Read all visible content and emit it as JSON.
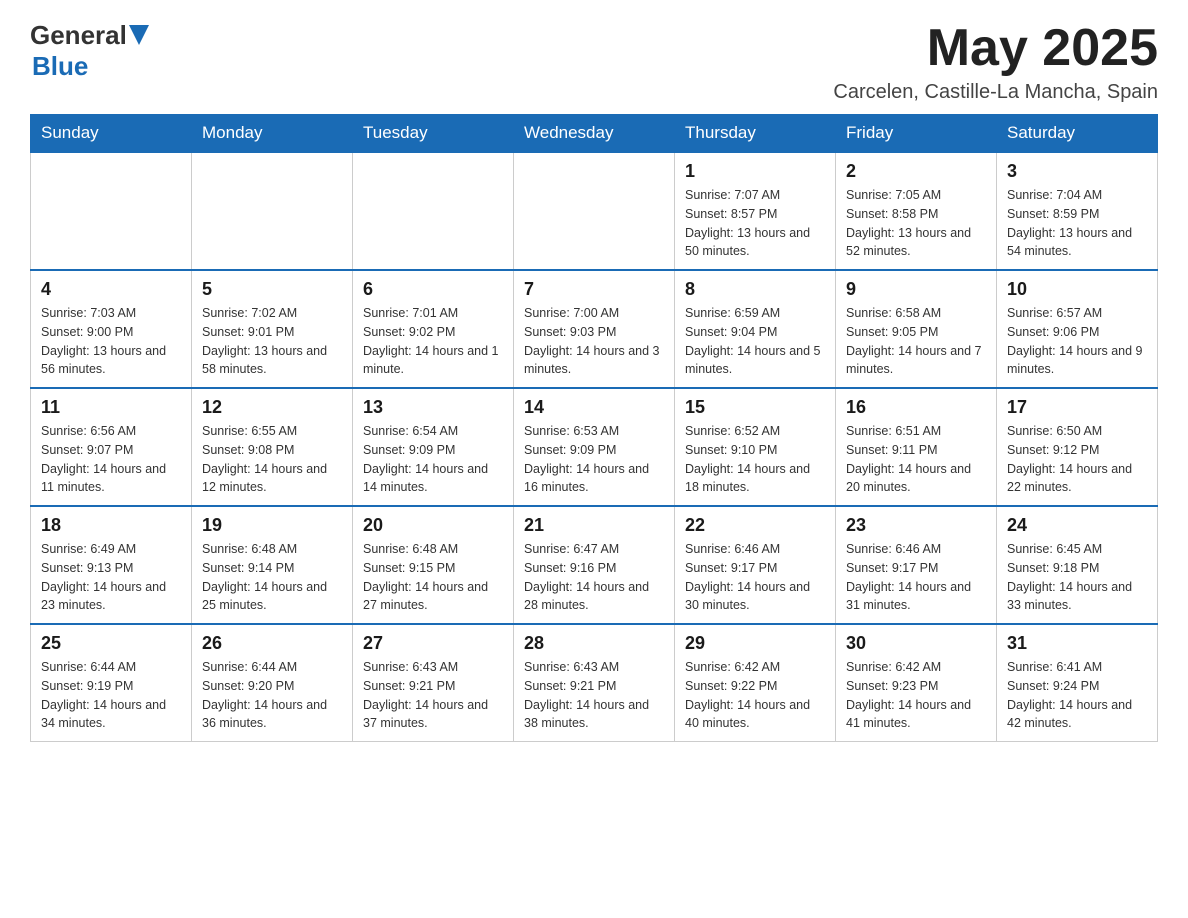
{
  "header": {
    "logo_general": "General",
    "logo_blue": "Blue",
    "month_title": "May 2025",
    "location": "Carcelen, Castille-La Mancha, Spain"
  },
  "weekdays": [
    "Sunday",
    "Monday",
    "Tuesday",
    "Wednesday",
    "Thursday",
    "Friday",
    "Saturday"
  ],
  "weeks": [
    [
      {
        "day": "",
        "sunrise": "",
        "sunset": "",
        "daylight": ""
      },
      {
        "day": "",
        "sunrise": "",
        "sunset": "",
        "daylight": ""
      },
      {
        "day": "",
        "sunrise": "",
        "sunset": "",
        "daylight": ""
      },
      {
        "day": "",
        "sunrise": "",
        "sunset": "",
        "daylight": ""
      },
      {
        "day": "1",
        "sunrise": "Sunrise: 7:07 AM",
        "sunset": "Sunset: 8:57 PM",
        "daylight": "Daylight: 13 hours and 50 minutes."
      },
      {
        "day": "2",
        "sunrise": "Sunrise: 7:05 AM",
        "sunset": "Sunset: 8:58 PM",
        "daylight": "Daylight: 13 hours and 52 minutes."
      },
      {
        "day": "3",
        "sunrise": "Sunrise: 7:04 AM",
        "sunset": "Sunset: 8:59 PM",
        "daylight": "Daylight: 13 hours and 54 minutes."
      }
    ],
    [
      {
        "day": "4",
        "sunrise": "Sunrise: 7:03 AM",
        "sunset": "Sunset: 9:00 PM",
        "daylight": "Daylight: 13 hours and 56 minutes."
      },
      {
        "day": "5",
        "sunrise": "Sunrise: 7:02 AM",
        "sunset": "Sunset: 9:01 PM",
        "daylight": "Daylight: 13 hours and 58 minutes."
      },
      {
        "day": "6",
        "sunrise": "Sunrise: 7:01 AM",
        "sunset": "Sunset: 9:02 PM",
        "daylight": "Daylight: 14 hours and 1 minute."
      },
      {
        "day": "7",
        "sunrise": "Sunrise: 7:00 AM",
        "sunset": "Sunset: 9:03 PM",
        "daylight": "Daylight: 14 hours and 3 minutes."
      },
      {
        "day": "8",
        "sunrise": "Sunrise: 6:59 AM",
        "sunset": "Sunset: 9:04 PM",
        "daylight": "Daylight: 14 hours and 5 minutes."
      },
      {
        "day": "9",
        "sunrise": "Sunrise: 6:58 AM",
        "sunset": "Sunset: 9:05 PM",
        "daylight": "Daylight: 14 hours and 7 minutes."
      },
      {
        "day": "10",
        "sunrise": "Sunrise: 6:57 AM",
        "sunset": "Sunset: 9:06 PM",
        "daylight": "Daylight: 14 hours and 9 minutes."
      }
    ],
    [
      {
        "day": "11",
        "sunrise": "Sunrise: 6:56 AM",
        "sunset": "Sunset: 9:07 PM",
        "daylight": "Daylight: 14 hours and 11 minutes."
      },
      {
        "day": "12",
        "sunrise": "Sunrise: 6:55 AM",
        "sunset": "Sunset: 9:08 PM",
        "daylight": "Daylight: 14 hours and 12 minutes."
      },
      {
        "day": "13",
        "sunrise": "Sunrise: 6:54 AM",
        "sunset": "Sunset: 9:09 PM",
        "daylight": "Daylight: 14 hours and 14 minutes."
      },
      {
        "day": "14",
        "sunrise": "Sunrise: 6:53 AM",
        "sunset": "Sunset: 9:09 PM",
        "daylight": "Daylight: 14 hours and 16 minutes."
      },
      {
        "day": "15",
        "sunrise": "Sunrise: 6:52 AM",
        "sunset": "Sunset: 9:10 PM",
        "daylight": "Daylight: 14 hours and 18 minutes."
      },
      {
        "day": "16",
        "sunrise": "Sunrise: 6:51 AM",
        "sunset": "Sunset: 9:11 PM",
        "daylight": "Daylight: 14 hours and 20 minutes."
      },
      {
        "day": "17",
        "sunrise": "Sunrise: 6:50 AM",
        "sunset": "Sunset: 9:12 PM",
        "daylight": "Daylight: 14 hours and 22 minutes."
      }
    ],
    [
      {
        "day": "18",
        "sunrise": "Sunrise: 6:49 AM",
        "sunset": "Sunset: 9:13 PM",
        "daylight": "Daylight: 14 hours and 23 minutes."
      },
      {
        "day": "19",
        "sunrise": "Sunrise: 6:48 AM",
        "sunset": "Sunset: 9:14 PM",
        "daylight": "Daylight: 14 hours and 25 minutes."
      },
      {
        "day": "20",
        "sunrise": "Sunrise: 6:48 AM",
        "sunset": "Sunset: 9:15 PM",
        "daylight": "Daylight: 14 hours and 27 minutes."
      },
      {
        "day": "21",
        "sunrise": "Sunrise: 6:47 AM",
        "sunset": "Sunset: 9:16 PM",
        "daylight": "Daylight: 14 hours and 28 minutes."
      },
      {
        "day": "22",
        "sunrise": "Sunrise: 6:46 AM",
        "sunset": "Sunset: 9:17 PM",
        "daylight": "Daylight: 14 hours and 30 minutes."
      },
      {
        "day": "23",
        "sunrise": "Sunrise: 6:46 AM",
        "sunset": "Sunset: 9:17 PM",
        "daylight": "Daylight: 14 hours and 31 minutes."
      },
      {
        "day": "24",
        "sunrise": "Sunrise: 6:45 AM",
        "sunset": "Sunset: 9:18 PM",
        "daylight": "Daylight: 14 hours and 33 minutes."
      }
    ],
    [
      {
        "day": "25",
        "sunrise": "Sunrise: 6:44 AM",
        "sunset": "Sunset: 9:19 PM",
        "daylight": "Daylight: 14 hours and 34 minutes."
      },
      {
        "day": "26",
        "sunrise": "Sunrise: 6:44 AM",
        "sunset": "Sunset: 9:20 PM",
        "daylight": "Daylight: 14 hours and 36 minutes."
      },
      {
        "day": "27",
        "sunrise": "Sunrise: 6:43 AM",
        "sunset": "Sunset: 9:21 PM",
        "daylight": "Daylight: 14 hours and 37 minutes."
      },
      {
        "day": "28",
        "sunrise": "Sunrise: 6:43 AM",
        "sunset": "Sunset: 9:21 PM",
        "daylight": "Daylight: 14 hours and 38 minutes."
      },
      {
        "day": "29",
        "sunrise": "Sunrise: 6:42 AM",
        "sunset": "Sunset: 9:22 PM",
        "daylight": "Daylight: 14 hours and 40 minutes."
      },
      {
        "day": "30",
        "sunrise": "Sunrise: 6:42 AM",
        "sunset": "Sunset: 9:23 PM",
        "daylight": "Daylight: 14 hours and 41 minutes."
      },
      {
        "day": "31",
        "sunrise": "Sunrise: 6:41 AM",
        "sunset": "Sunset: 9:24 PM",
        "daylight": "Daylight: 14 hours and 42 minutes."
      }
    ]
  ]
}
